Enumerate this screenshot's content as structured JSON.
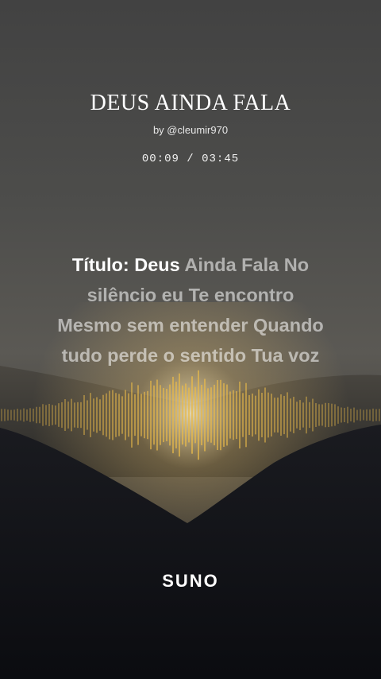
{
  "song": {
    "title": "DEUS AINDA FALA",
    "author": "by @cleumir970",
    "time_current": "00:09",
    "time_separator": "/",
    "time_total": "03:45"
  },
  "lyrics": {
    "line1_active": "Título: Deus",
    "line1_rest": "Ainda Fala No",
    "line2": "silêncio eu Te encontro",
    "line3": "Mesmo sem entender Quando",
    "line4": "tudo perde o sentido Tua voz"
  },
  "brand": {
    "logo_text": "SUNO"
  },
  "colors": {
    "accent_gold": "#e8b94a",
    "background_dark": "#0b0c10"
  }
}
